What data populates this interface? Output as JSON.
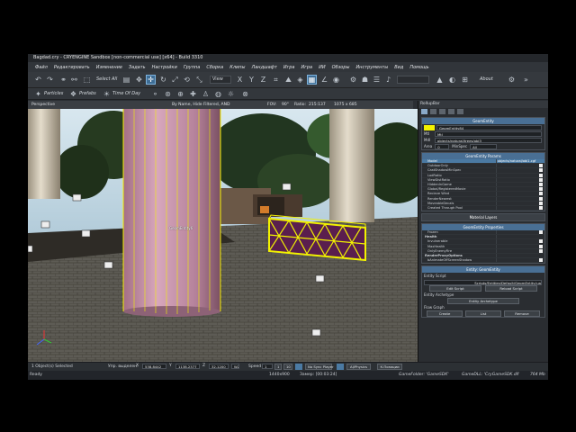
{
  "window": {
    "title": "Bagdad.cry - CRYENGINE Sandbox [non-commercial use] [x64] - Build 3310"
  },
  "menu": [
    "Файл",
    "Редактировать",
    "Изменение",
    "Задать",
    "Настройки",
    "Группа",
    "Сборка",
    "Клипы",
    "Ландшафт",
    "Игра",
    "Игра",
    "ИИ",
    "Обзоры",
    "Инструменты",
    "Вид",
    "Помощь"
  ],
  "toolbar": {
    "select_all": "Select All",
    "view_select": "View",
    "axes": [
      "X",
      "Y",
      "Z"
    ],
    "about_label": "About",
    "row2": [
      "Particles",
      "Prefabs",
      "Time Of Day"
    ]
  },
  "viewport": {
    "perspective_label": "Perspective",
    "filter_label": "By Name, Hide Filtered, AND",
    "fov_label": "FOV:",
    "fov_value": "90°",
    "ratio_label": "Ratio:",
    "ratio_value": "215:137",
    "resolution": "1075 x 685",
    "object_label": "GeomEntity6"
  },
  "status": {
    "selected": "1 Object(s) Selected",
    "snap_label": "Упр. выделен.",
    "x_value": "538.8442",
    "y_value": "1138.2377",
    "z_value": "32.1200",
    "grid_value": "WZ",
    "speed_label": "Speed",
    "speed_value": "1",
    "speed_unit": "1",
    "speed_unit2": "10",
    "sync_label": "No Sync Player",
    "ai_label": "AI/Physics",
    "ai_label2": "К.Позиции",
    "ready": "Ready",
    "memory": "1440x900",
    "coords": "Замер: [00:03:24]",
    "gamefolder": "GameFolder: 'GameSDK'",
    "gamedll": "GameDLL: 'CryGameSDK.dll'",
    "mem2": "764 Mb"
  },
  "panel": {
    "title": "RollupBar",
    "geom_entity": {
      "header": "GeomEntity",
      "name": "GeomEntity84",
      "mtl_label": "Mtl",
      "mtl_value": "Mtl",
      "obj_value": "objects/natural/trees/obi3",
      "area_label": "Area",
      "area_value": "0",
      "mindspec_label": "MinSpec",
      "mindspec_value": "All"
    },
    "params": {
      "header": "GeomEntity Params",
      "rows": [
        {
          "k": "Model",
          "v": "objects/natural/obi1.cgf",
          "sel": true
        },
        {
          "k": "OutdoorOnly",
          "v": ""
        },
        {
          "k": "CastShadowMinSpec",
          "v": ""
        },
        {
          "k": "LodRatio",
          "v": ""
        },
        {
          "k": "ViewDistRatio",
          "v": ""
        },
        {
          "k": "HiddenInGame",
          "v": ""
        },
        {
          "k": "Global/RegisteredMovie",
          "v": ""
        },
        {
          "k": "Recieve Wind",
          "v": ""
        },
        {
          "k": "RenderNearest",
          "v": ""
        },
        {
          "k": "MoveableDecals",
          "v": ""
        },
        {
          "k": "Created Through Pool",
          "v": ""
        }
      ]
    },
    "material_layers": "Material Layers",
    "geom_props": {
      "header": "GeomEntity Properties",
      "rows": [
        {
          "k": "Frozen",
          "v": ""
        },
        {
          "k": "Health",
          "v": "",
          "bold": true
        },
        {
          "k": "Invulnerable",
          "v": ""
        },
        {
          "k": "MaxHealth",
          "v": ""
        },
        {
          "k": "OnlyEnemyFire",
          "v": ""
        },
        {
          "k": "RenderProxyOptions",
          "v": "",
          "bold": true
        },
        {
          "k": "bAnimateOffScreenShadow",
          "v": ""
        }
      ]
    },
    "entity_geom": {
      "header": "Entity: GeomEntity",
      "script_label": "Entity Script",
      "script_value": "Scripts/Entities/Default/GeomEntity.lua",
      "edit_script": "Edit Script",
      "reload_script": "Reload Script"
    },
    "archetype": {
      "label": "Entity Archetype",
      "button": "Entity Archetype"
    },
    "flow_graph": {
      "label": "Flow Graph",
      "create": "Create",
      "list": "List",
      "remove": "Remove"
    }
  },
  "colors": {
    "accent": "#4b7aa3",
    "selection_yellow": "#f2f200"
  }
}
